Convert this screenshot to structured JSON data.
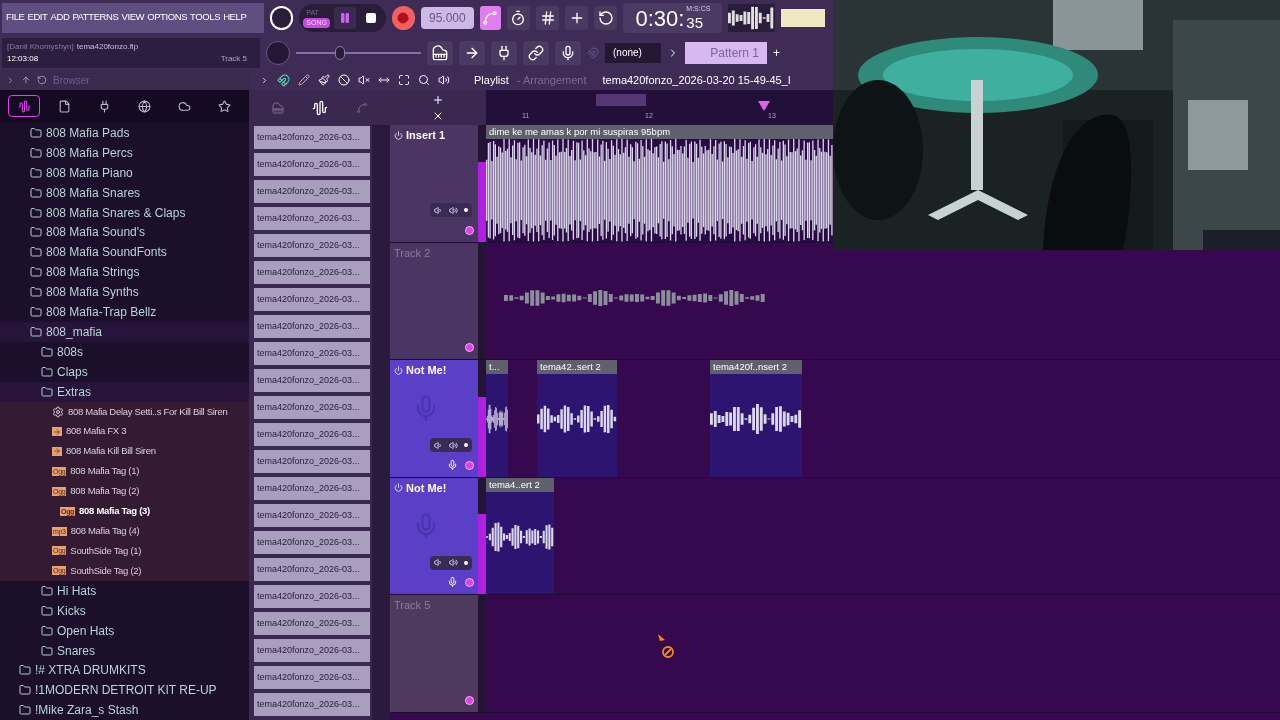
{
  "menu": [
    "FILE",
    "EDIT",
    "ADD",
    "PATTERNS",
    "VIEW",
    "OPTIONS",
    "TOOLS",
    "HELP"
  ],
  "hint": {
    "user": "[Danil Khomyshyn]",
    "file": "tema420fonzo.flp",
    "time": "12:03:08",
    "track": "Track 5"
  },
  "transport": {
    "modes": [
      {
        "label": "PAT",
        "selected": false
      },
      {
        "label": "SONG",
        "selected": true
      }
    ],
    "playing": true,
    "tempo": "95.000",
    "time": "0:30:",
    "time_cs": "35",
    "time_unit": "M:S:CS"
  },
  "volume": {
    "level": 0.35
  },
  "snap": "(none)",
  "pattern": "Pattern 1",
  "pattern_add": "+",
  "browser": {
    "title": "Browser",
    "tabs": [
      {
        "kind": "all",
        "selected": true
      },
      {
        "kind": "files",
        "selected": false
      },
      {
        "kind": "plugins",
        "selected": false
      },
      {
        "kind": "online",
        "selected": false
      },
      {
        "kind": "cloud",
        "selected": false
      },
      {
        "kind": "favorites",
        "selected": false
      }
    ],
    "tree": [
      {
        "children": [
          {
            "kind": "folder",
            "name": "808 Mafia Pads"
          },
          {
            "kind": "folder",
            "name": "808 Mafia Percs"
          },
          {
            "kind": "folder",
            "name": "808 Mafia Piano"
          },
          {
            "kind": "folder",
            "name": "808 Mafia Snares"
          },
          {
            "kind": "folder",
            "name": "808 Mafia Snares & Claps"
          },
          {
            "kind": "folder",
            "name": "808 Mafia Sound's"
          },
          {
            "kind": "folder",
            "name": "808 Mafia SoundFonts"
          },
          {
            "kind": "folder",
            "name": "808 Mafia Strings"
          },
          {
            "kind": "folder",
            "name": "808 Mafia Synths"
          },
          {
            "kind": "folder",
            "name": "808 Mafia-Trap Bellz"
          },
          {
            "kind": "folder",
            "name": "808_mafia",
            "expanded": true,
            "children": [
              {
                "kind": "folder",
                "name": "808s"
              },
              {
                "kind": "folder",
                "name": "Claps"
              },
              {
                "kind": "folder",
                "name": "Extras",
                "expanded": true,
                "children": [
                  {
                    "kind": "preset",
                    "name": "808 Mafia Delay Setti..s For Kill Bill Siren",
                    "selected": false
                  },
                  {
                    "kind": "audio",
                    "name": "808 Mafia FX 3",
                    "selected": false
                  },
                  {
                    "kind": "audio",
                    "name": "808 Mafia Kill Bill Siren",
                    "selected": false
                  },
                  {
                    "kind": "file",
                    "badge": "Ogg",
                    "name": "808 Mafia Tag (1)",
                    "selected": false
                  },
                  {
                    "kind": "file",
                    "badge": "Ogg",
                    "name": "808 Mafia Tag (2)",
                    "selected": false
                  },
                  {
                    "kind": "file",
                    "badge": "Ogg",
                    "name": "808 Mafia Tag (3)",
                    "selected": true
                  },
                  {
                    "kind": "file",
                    "badge": "mp3",
                    "name": "808 Mafia Tag (4)",
                    "selected": false
                  },
                  {
                    "kind": "file",
                    "badge": "Ogg",
                    "name": "SouthSide Tag (1)",
                    "selected": false
                  },
                  {
                    "kind": "file",
                    "badge": "Ogg",
                    "name": "SouthSide Tag (2)",
                    "selected": false
                  }
                ]
              },
              {
                "kind": "folder",
                "name": "Hi Hats"
              },
              {
                "kind": "folder",
                "name": "Kicks"
              },
              {
                "kind": "folder",
                "name": "Open Hats"
              },
              {
                "kind": "folder",
                "name": "Snares"
              }
            ]
          }
        ]
      },
      {
        "kind": "folder",
        "name": "!# XTRA DRUMKITS"
      },
      {
        "kind": "folder",
        "name": "!1MODERN DETROIT KIT RE-UP"
      },
      {
        "kind": "folder",
        "name": "!Mike Zara_s Stash"
      }
    ]
  },
  "playlist": {
    "title": "Playlist",
    "subtitle": "- Arrangement",
    "file": "tema420fonzo_2026-03-20 15-49-45_I",
    "bars": [
      "11",
      "12",
      "13"
    ]
  },
  "picker": [
    "tema420fonzo_2026-03...",
    "tema420fonzo_2026-03...",
    "tema420fonzo_2026-03...",
    "tema420fonzo_2026-03...",
    "tema420fonzo_2026-03...",
    "tema420fonzo_2026-03...",
    "tema420fonzo_2026-03...",
    "tema420fonzo_2026-03...",
    "tema420fonzo_2026-03...",
    "tema420fonzo_2026-03...",
    "tema420fonzo_2026-03...",
    "tema420fonzo_2026-03...",
    "tema420fonzo_2026-03...",
    "tema420fonzo_2026-03...",
    "tema420fonzo_2026-03...",
    "tema420fonzo_2026-03...",
    "tema420fonzo_2026-03...",
    "tema420fonzo_2026-03...",
    "tema420fonzo_2026-03...",
    "tema420fonzo_2026-03...",
    "tema420fonzo_2026-03...",
    "tema420fonzo_2026-03..."
  ],
  "tracks": [
    {
      "kind": "insert",
      "name": "Insert 1",
      "color": "#4a3563",
      "clips": [
        {
          "kind": "audio",
          "label": "dime ke me amas k por mi suspiras 95bpm"
        }
      ]
    },
    {
      "kind": "empty",
      "name": "Track 2",
      "color": "#4a3563",
      "clips": [
        {
          "kind": "ghost"
        }
      ]
    },
    {
      "kind": "vocal",
      "name": "Not Me!",
      "color": "#5b3fc6",
      "clips": [
        {
          "kind": "audio",
          "label": "t..."
        },
        {
          "kind": "audio",
          "label": "tema42..sert 2"
        },
        {
          "kind": "audio",
          "label": "tema420f..nsert 2"
        }
      ]
    },
    {
      "kind": "vocal",
      "name": "Not Me!",
      "color": "#5b3fc6",
      "clips": [
        {
          "kind": "audio",
          "label": "tema4..ert 2"
        }
      ]
    },
    {
      "kind": "empty",
      "name": "Track 5",
      "color": "#4e3a5c"
    }
  ]
}
